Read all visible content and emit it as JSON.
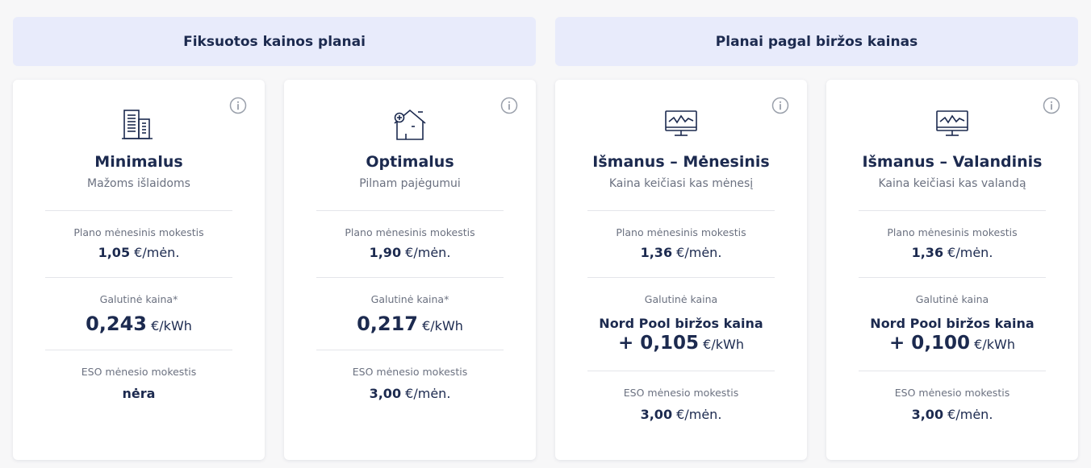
{
  "groups": {
    "fixed": "Fiksuotos kainos planai",
    "exchange": "Planai pagal biržos kainas"
  },
  "plans": [
    {
      "icon": "building-icon",
      "title": "Minimalus",
      "subtitle": "Mažoms išlaidoms",
      "fee_label": "Plano mėnesinis mokestis",
      "fee_value": "1,05",
      "fee_unit": "€/mėn.",
      "final_label": "Galutinė kaina*",
      "final_value": "0,243",
      "final_unit": "€/kWh",
      "eso_label": "ESO mėnesio mokestis",
      "eso_value": "nėra",
      "eso_unit": ""
    },
    {
      "icon": "house-plus-minus-icon",
      "title": "Optimalus",
      "subtitle": "Pilnam pajėgumui",
      "fee_label": "Plano mėnesinis mokestis",
      "fee_value": "1,90",
      "fee_unit": "€/mėn.",
      "final_label": "Galutinė kaina*",
      "final_value": "0,217",
      "final_unit": "€/kWh",
      "eso_label": "ESO mėnesio mokestis",
      "eso_value": "3,00",
      "eso_unit": "€/mėn."
    },
    {
      "icon": "monitor-chart-icon",
      "title": "Išmanus – Mėnesinis",
      "subtitle": "Kaina keičiasi kas mėnesį",
      "fee_label": "Plano mėnesinis mokestis",
      "fee_value": "1,36",
      "fee_unit": "€/mėn.",
      "final_label": "Galutinė kaina",
      "nordpool_text": "Nord Pool biržos kaina",
      "final_value": "+ 0,105",
      "final_unit": "€/kWh",
      "eso_label": "ESO mėnesio mokestis",
      "eso_value": "3,00",
      "eso_unit": "€/mėn."
    },
    {
      "icon": "monitor-chart-icon",
      "title": "Išmanus – Valandinis",
      "subtitle": "Kaina keičiasi kas valandą",
      "fee_label": "Plano mėnesinis mokestis",
      "fee_value": "1,36",
      "fee_unit": "€/mėn.",
      "final_label": "Galutinė kaina",
      "nordpool_text": "Nord Pool biržos kaina",
      "final_value": "+ 0,100",
      "final_unit": "€/kWh",
      "eso_label": "ESO mėnesio mokestis",
      "eso_value": "3,00",
      "eso_unit": "€/mėn."
    }
  ]
}
